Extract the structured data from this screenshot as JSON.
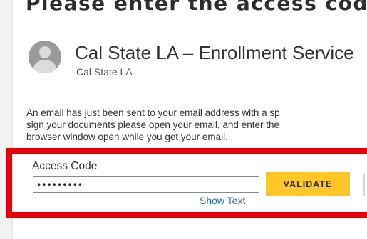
{
  "page": {
    "title": "Please enter the access code"
  },
  "sender": {
    "avatar_icon": "user-avatar-icon",
    "name": "Cal State LA – Enrollment Service",
    "organization": "Cal State LA"
  },
  "message": {
    "lines": [
      "An email has just been sent to your email address with a sp",
      "sign your documents please open your email, and enter the",
      "browser window open while you get your email."
    ]
  },
  "access_code": {
    "label": "Access Code",
    "value": "•••••••••",
    "validate_label": "VALIDATE",
    "show_text_label": "Show Text"
  },
  "colors": {
    "highlight_border": "#e8000b",
    "validate_button": "#ffc627",
    "link": "#1f6eb3"
  }
}
